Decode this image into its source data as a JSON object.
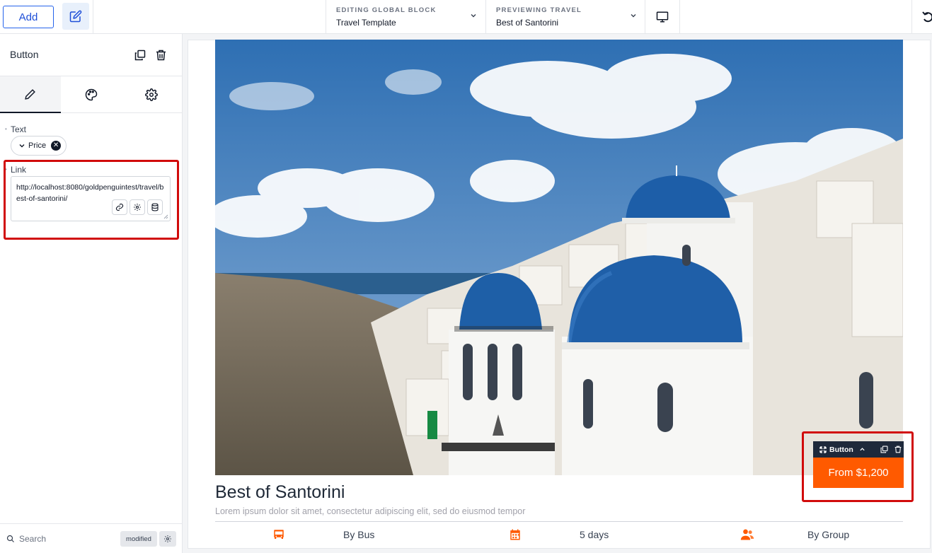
{
  "topbar": {
    "add_label": "Add",
    "editing": {
      "caption": "EDITING GLOBAL BLOCK",
      "value": "Travel Template"
    },
    "previewing": {
      "caption": "PREVIEWING TRAVEL",
      "value": "Best of Santorini"
    },
    "device_icon": "desktop-icon"
  },
  "sidebar": {
    "title": "Button",
    "tabs": [
      "pencil-icon",
      "palette-icon",
      "gear-icon"
    ],
    "text_field": {
      "label": "Text",
      "chip_label": "Price"
    },
    "link_field": {
      "label": "Link",
      "value": "http://localhost:8080/goldpenguintest/travel/best-of-santorini/"
    },
    "footer": {
      "search_placeholder": "Search",
      "badge": "modified"
    }
  },
  "canvas": {
    "title": "Best of Santorini",
    "description": "Lorem ipsum dolor sit amet, consectetur adipiscing elit, sed do eiusmod tempor",
    "info": [
      {
        "icon": "bus-icon",
        "label": "By Bus"
      },
      {
        "icon": "calendar-icon",
        "label": "5 days"
      },
      {
        "icon": "group-icon",
        "label": "By Group"
      }
    ],
    "selected_button": {
      "toolbar_label": "Button",
      "label": "From $1,200"
    }
  },
  "colors": {
    "accent": "#ff5a00",
    "highlight": "#d10b0b",
    "primary": "#2563eb",
    "toolbar": "#1e293b"
  }
}
